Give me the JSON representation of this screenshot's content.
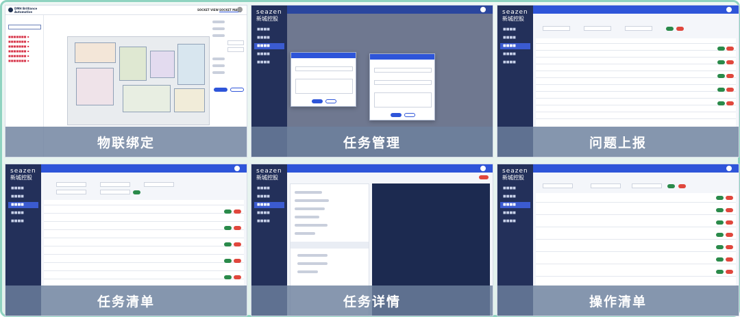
{
  "tiles": [
    {
      "caption": "物联绑定",
      "app_title": "DMH Brilliance Automotive",
      "tabs": [
        "SOCKET VIEW",
        "SOCKET MARK"
      ]
    },
    {
      "caption": "任务管理",
      "logo_top": "seazen",
      "logo_bottom": "新城控股"
    },
    {
      "caption": "问题上报",
      "logo_top": "seazen",
      "logo_bottom": "新城控股"
    },
    {
      "caption": "任务清单",
      "logo_top": "seazen",
      "logo_bottom": "新城控股"
    },
    {
      "caption": "任务详情",
      "logo_top": "seazen",
      "logo_bottom": "新城控股"
    },
    {
      "caption": "操作清单",
      "logo_top": "seazen",
      "logo_bottom": "新城控股"
    }
  ],
  "colors": {
    "sidebar": "#23305a",
    "topbar": "#2e55d9",
    "accent": "#3b5bd0",
    "frame": "#8fd3c0",
    "caption_bg": "#6c809e"
  }
}
